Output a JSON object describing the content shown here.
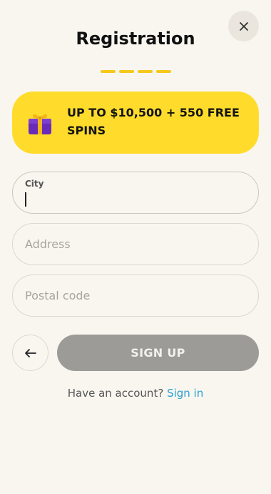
{
  "header": {
    "title": "Registration",
    "steps_total": 4,
    "step_color": "#f5c91c"
  },
  "promo": {
    "text": "UP TO $10,500 + 550 FREE SPINS",
    "icon": "gift-icon",
    "background": "#ffdc2b"
  },
  "form": {
    "city": {
      "label": "City",
      "value": ""
    },
    "address": {
      "placeholder": "Address",
      "value": ""
    },
    "postal_code": {
      "placeholder": "Postal code",
      "value": ""
    }
  },
  "actions": {
    "back_icon": "arrow-left-icon",
    "signup_label": "SIGN UP"
  },
  "footer": {
    "prompt": "Have an account?",
    "signin_label": "Sign in",
    "link_color": "#2a9fd0"
  },
  "close_icon": "close-icon"
}
